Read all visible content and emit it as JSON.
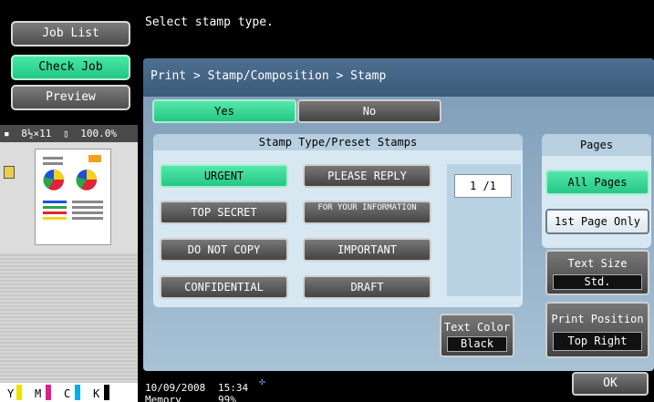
{
  "sidebar": {
    "job_list": "Job List",
    "check_job": "Check Job",
    "preview": "Preview",
    "status": {
      "paper_size": "8½×11",
      "zoom": "100.0%"
    },
    "toner": {
      "y": "Y",
      "m": "M",
      "c": "C",
      "k": "K"
    }
  },
  "message": "Select stamp type.",
  "breadcrumb": "Print > Stamp/Composition > Stamp",
  "toggle": {
    "yes": "Yes",
    "no": "No"
  },
  "stamp_group": {
    "title": "Stamp Type/Preset Stamps",
    "items": [
      "URGENT",
      "PLEASE REPLY",
      "TOP SECRET",
      "FOR YOUR INFORMATION",
      "DO NOT COPY",
      "IMPORTANT",
      "CONFIDENTIAL",
      "DRAFT"
    ],
    "selected": "URGENT",
    "page_counter": "1  /1"
  },
  "pages_group": {
    "title": "Pages",
    "all_pages": "All Pages",
    "first_page_only": "1st Page Only"
  },
  "text_size": {
    "label": "Text Size",
    "value": "Std."
  },
  "print_position": {
    "label": "Print Position",
    "value": "Top Right"
  },
  "text_color": {
    "label": "Text Color",
    "value": "Black"
  },
  "status_bar": {
    "date": "10/09/2008",
    "time": "15:34",
    "memory_label": "Memory",
    "memory_value": "99%"
  },
  "ok_button": "OK",
  "colors": {
    "selected_green": "#2fd48f",
    "panel_blue": "#8eadc6",
    "header_blue": "#3f5f7f"
  }
}
